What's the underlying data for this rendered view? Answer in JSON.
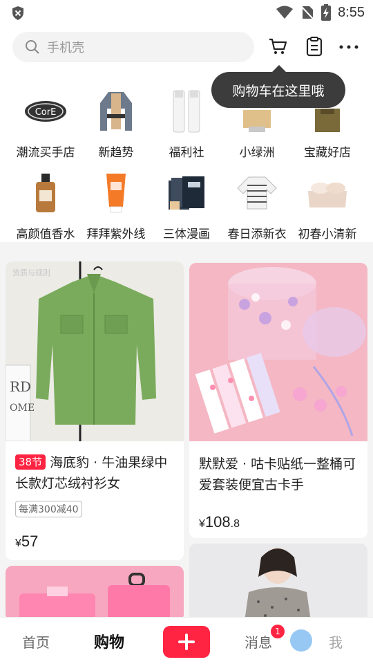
{
  "status": {
    "time": "8:55"
  },
  "search": {
    "placeholder": "手机壳"
  },
  "tooltip": {
    "text": "购物车在这里哦"
  },
  "categories": [
    {
      "label": "潮流买手店",
      "icon": "core-logo"
    },
    {
      "label": "新趋势",
      "icon": "jacket"
    },
    {
      "label": "福利社",
      "icon": "skincare-bottles"
    },
    {
      "label": "小绿洲",
      "icon": "clothing"
    },
    {
      "label": "宝藏好店",
      "icon": "shirt"
    },
    {
      "label": "高颜值香水",
      "icon": "perfume"
    },
    {
      "label": "拜拜紫外线",
      "icon": "sunscreen"
    },
    {
      "label": "三体漫画",
      "icon": "comic-books"
    },
    {
      "label": "春日添新衣",
      "icon": "striped-top"
    },
    {
      "label": "初春小清新",
      "icon": "bedding"
    }
  ],
  "feed": {
    "card1": {
      "badge": "38节",
      "title": "海底豹 · 牛油果绿中长款灯芯绒衬衫女",
      "coupon": "每满300减40",
      "price_symbol": "¥",
      "price": "57",
      "img_tag": "资质与规则"
    },
    "card2": {
      "title": "默默爱 · 咕卡贴纸一整桶可爱套装便宜古卡手",
      "price_symbol": "¥",
      "price_int": "108",
      "price_dec": ".8"
    }
  },
  "bottom_nav": {
    "home": "首页",
    "shop": "购物",
    "messages": "消息",
    "me": "我",
    "msg_badge": "1"
  },
  "colors": {
    "accent": "#ff2442",
    "tooltip": "#3c3c3c"
  }
}
